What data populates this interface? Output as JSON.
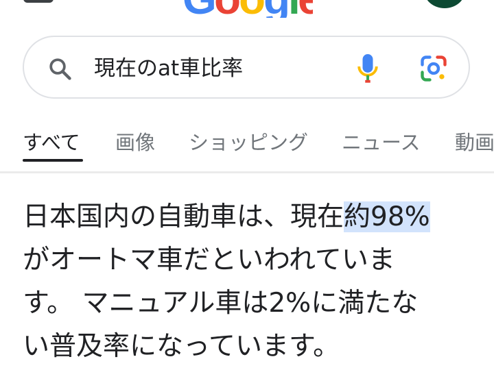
{
  "header": {
    "logo_text": "Google",
    "logo_colors": [
      "#4285f4",
      "#ea4335",
      "#fbbc05",
      "#4285f4",
      "#34a853",
      "#ea4335"
    ]
  },
  "search": {
    "query": "現在のat車比率"
  },
  "tabs": [
    {
      "label": "すべて",
      "active": true
    },
    {
      "label": "画像",
      "active": false
    },
    {
      "label": "ショッピング",
      "active": false
    },
    {
      "label": "ニュース",
      "active": false
    },
    {
      "label": "動画",
      "active": false
    }
  ],
  "answer": {
    "line1_pre": "日本国内の自動車は、現在",
    "line1_highlight": "約98%",
    "line2": "がオートマ車だといわれていま",
    "line3": "す。 マニュアル車は2%に満たな",
    "line4": "い普及率になっています。",
    "highlight_color": "#d2e3fc"
  }
}
